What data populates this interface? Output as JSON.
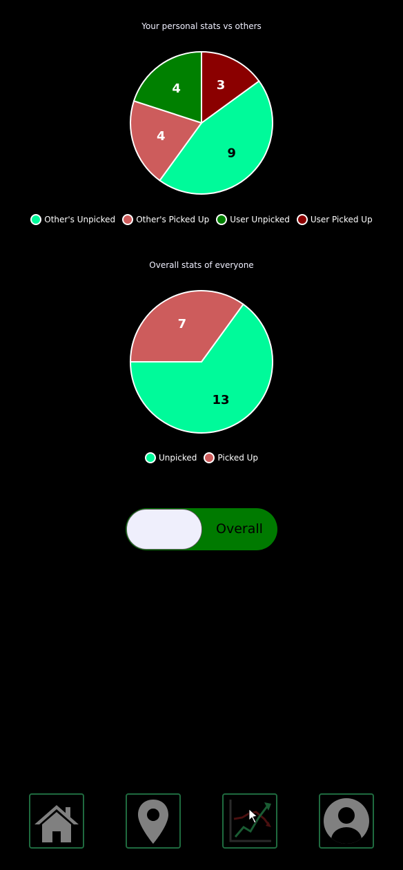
{
  "colors": {
    "others_unpicked": "#00fa9a",
    "others_picked_up": "#cd5c5c",
    "user_unpicked": "#008000",
    "user_picked_up": "#8b0000",
    "toggle_on": "#007a00",
    "nav_border": "#1f6b3f"
  },
  "chart_data": [
    {
      "type": "pie",
      "title": "Your personal stats vs others",
      "slices": [
        {
          "label": "Other's Unpicked",
          "value": 9,
          "color": "#00fa9a",
          "text_color": "#000000"
        },
        {
          "label": "Other's Picked Up",
          "value": 4,
          "color": "#cd5c5c",
          "text_color": "#ffffff"
        },
        {
          "label": "User Unpicked",
          "value": 4,
          "color": "#008000",
          "text_color": "#ffffff"
        },
        {
          "label": "User Picked Up",
          "value": 3,
          "color": "#8b0000",
          "text_color": "#ffffff"
        }
      ],
      "legend_position": "bottom"
    },
    {
      "type": "pie",
      "title": "Overall stats of everyone",
      "slices": [
        {
          "label": "Unpicked",
          "value": 13,
          "color": "#00fa9a",
          "text_color": "#000000"
        },
        {
          "label": "Picked Up",
          "value": 7,
          "color": "#cd5c5c",
          "text_color": "#ffffff"
        }
      ],
      "legend_position": "bottom"
    }
  ],
  "toggle": {
    "label": "Overall",
    "state": "on"
  },
  "nav": {
    "items": [
      {
        "name": "home",
        "icon": "home-icon"
      },
      {
        "name": "map",
        "icon": "map-pin-icon"
      },
      {
        "name": "stats",
        "icon": "stats-chart-icon",
        "active": true
      },
      {
        "name": "profile",
        "icon": "user-profile-icon"
      }
    ]
  }
}
